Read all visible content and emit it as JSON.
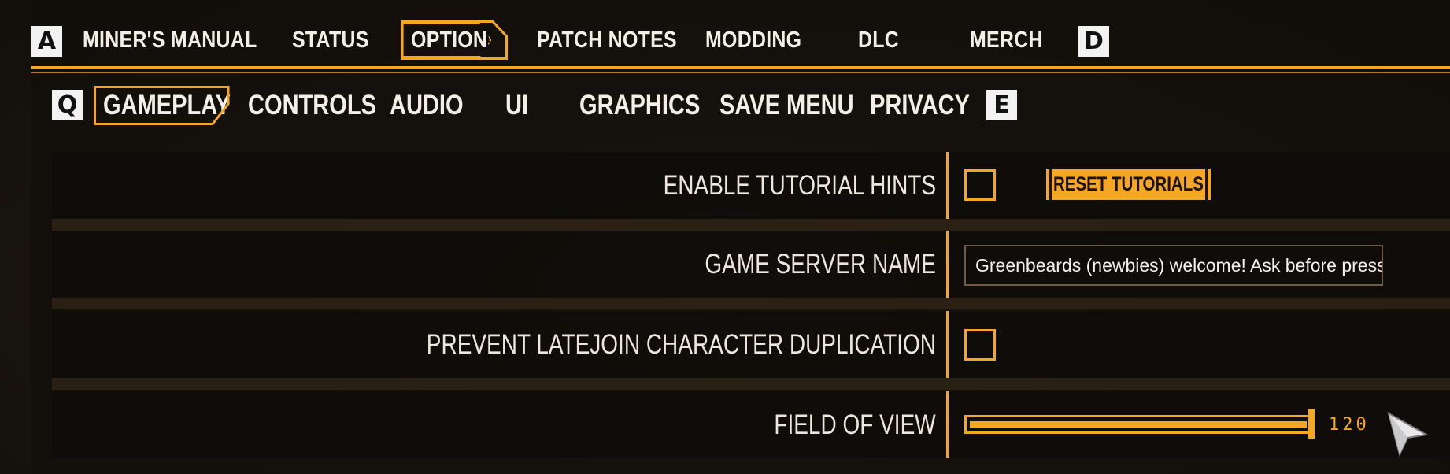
{
  "colors": {
    "accent": "#f5a623",
    "text": "#f3efe8",
    "key_bg": "#f2f2f2"
  },
  "top_nav": {
    "left_key": "A",
    "right_key": "D",
    "tabs": [
      "MINER'S MANUAL",
      "STATUS",
      "OPTIONS",
      "PATCH NOTES",
      "MODDING",
      "DLC",
      "MERCH"
    ],
    "active": "OPTIONS"
  },
  "sub_nav": {
    "left_key": "Q",
    "right_key": "E",
    "tabs": [
      "GAMEPLAY",
      "CONTROLS",
      "AUDIO",
      "UI",
      "GRAPHICS",
      "SAVE MENU",
      "PRIVACY"
    ],
    "active": "GAMEPLAY"
  },
  "settings": {
    "tutorial_hints": {
      "label": "ENABLE TUTORIAL HINTS",
      "checked": false,
      "button_label": "RESET TUTORIALS"
    },
    "server_name": {
      "label": "GAME SERVER NAME",
      "value": "Greenbeards (newbies) welcome! Ask before pressing"
    },
    "prevent_latejoin": {
      "label": "PREVENT LATEJOIN CHARACTER DUPLICATION",
      "checked": false
    },
    "field_of_view": {
      "label": "FIELD OF VIEW",
      "value": "120",
      "level": 1.0
    }
  },
  "icons": {
    "cursor": "pointer-arrow-icon"
  }
}
